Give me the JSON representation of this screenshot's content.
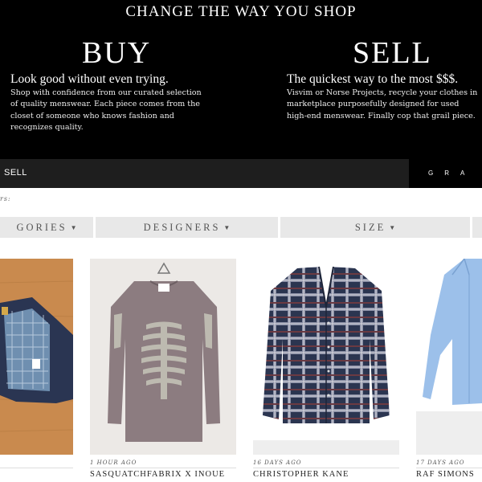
{
  "hero": {
    "title": "CHANGE THE WAY YOU SHOP",
    "buy": {
      "heading": "BUY",
      "subheading": "Look good without even trying.",
      "description_lines": [
        "Shop with confidence from our curated selection",
        "of quality menswear. Each piece comes from the",
        "closet of someone who knows fashion and",
        "recognizes quality."
      ]
    },
    "sell": {
      "heading": "SELL",
      "subheading": "The quickest way to the most $$$.",
      "description_lines": [
        "Visvim or Norse Projects, recycle your clothes in",
        "marketplace purposefully designed for used",
        "high-end menswear. Finally cop that grail piece."
      ]
    }
  },
  "navbar": {
    "sell_label": "SELL",
    "right_label": "GRA"
  },
  "filter_bar": {
    "label": "rs:",
    "filters": [
      {
        "label": "GORIES"
      },
      {
        "label": "DESIGNERS"
      },
      {
        "label": "SIZE"
      }
    ]
  },
  "listings": [
    {
      "time": "",
      "designer": "",
      "image": "blue-plaid-lined-jacket"
    },
    {
      "time": "1 HOUR AGO",
      "designer": "SASQUATCHFABRIX X INOUE",
      "image": "skeleton-print-sweater"
    },
    {
      "time": "16 DAYS AGO",
      "designer": "CHRISTOPHER KANE",
      "image": "plaid-cardigan"
    },
    {
      "time": "17 DAYS AGO",
      "designer": "RAF SIMONS",
      "image": "light-blue-shirt"
    }
  ],
  "colors": {
    "hero_bg": "#000000",
    "navbar_bg": "#1e1e1e",
    "filter_bg": "#e8e8e8"
  }
}
